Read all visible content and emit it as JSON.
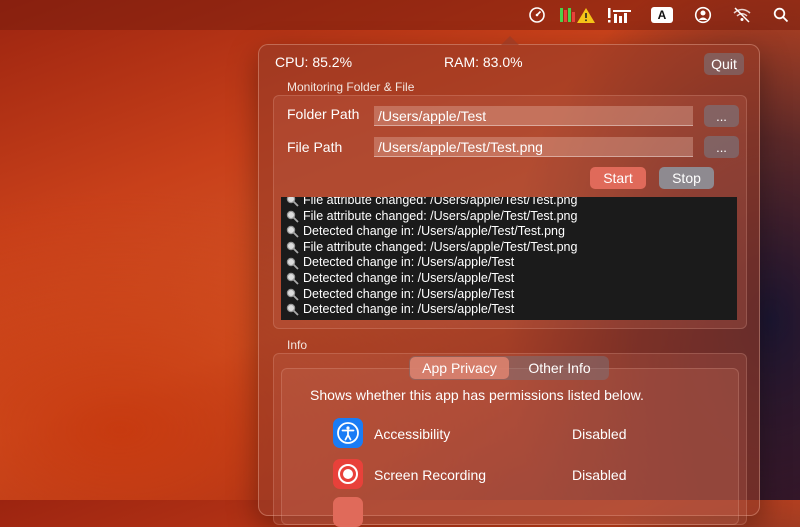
{
  "menubar": {
    "icons": [
      "speedometer-icon",
      "battery-bars-warning-icon",
      "stats-icon",
      "input-source-icon",
      "user-icon",
      "wifi-off-icon",
      "search-icon"
    ],
    "input_source_label": "A"
  },
  "stats": {
    "cpu": "CPU: 85.2%",
    "ram": "RAM: 83.0%",
    "quit_label": "Quit"
  },
  "monitoring": {
    "title": "Monitoring Folder & File",
    "folder_label": "Folder Path",
    "folder_value": "/Users/apple/Test",
    "file_label": "File Path",
    "file_value": "/Users/apple/Test/Test.png",
    "browse_label": "...",
    "start_label": "Start",
    "stop_label": "Stop"
  },
  "log": [
    "File attribute changed: /Users/apple/Test/Test.png",
    "File attribute changed: /Users/apple/Test/Test.png",
    "Detected change in: /Users/apple/Test/Test.png",
    "File attribute changed: /Users/apple/Test/Test.png",
    "Detected change in: /Users/apple/Test",
    "Detected change in: /Users/apple/Test",
    "Detected change in: /Users/apple/Test",
    "Detected change in: /Users/apple/Test"
  ],
  "info": {
    "title": "Info",
    "tabs": [
      "App Privacy",
      "Other Info"
    ],
    "active_tab": "App Privacy",
    "description": "Shows whether this app has permissions listed below.",
    "permissions": [
      {
        "name": "Accessibility",
        "status": "Disabled",
        "icon": "accessibility-icon",
        "color": "#1a7cf5"
      },
      {
        "name": "Screen Recording",
        "status": "Disabled",
        "icon": "screen-recording-icon",
        "color": "#e8413a"
      }
    ]
  },
  "colors": {
    "start_button": "#e06a5a",
    "stop_button": "#8e8a90"
  }
}
